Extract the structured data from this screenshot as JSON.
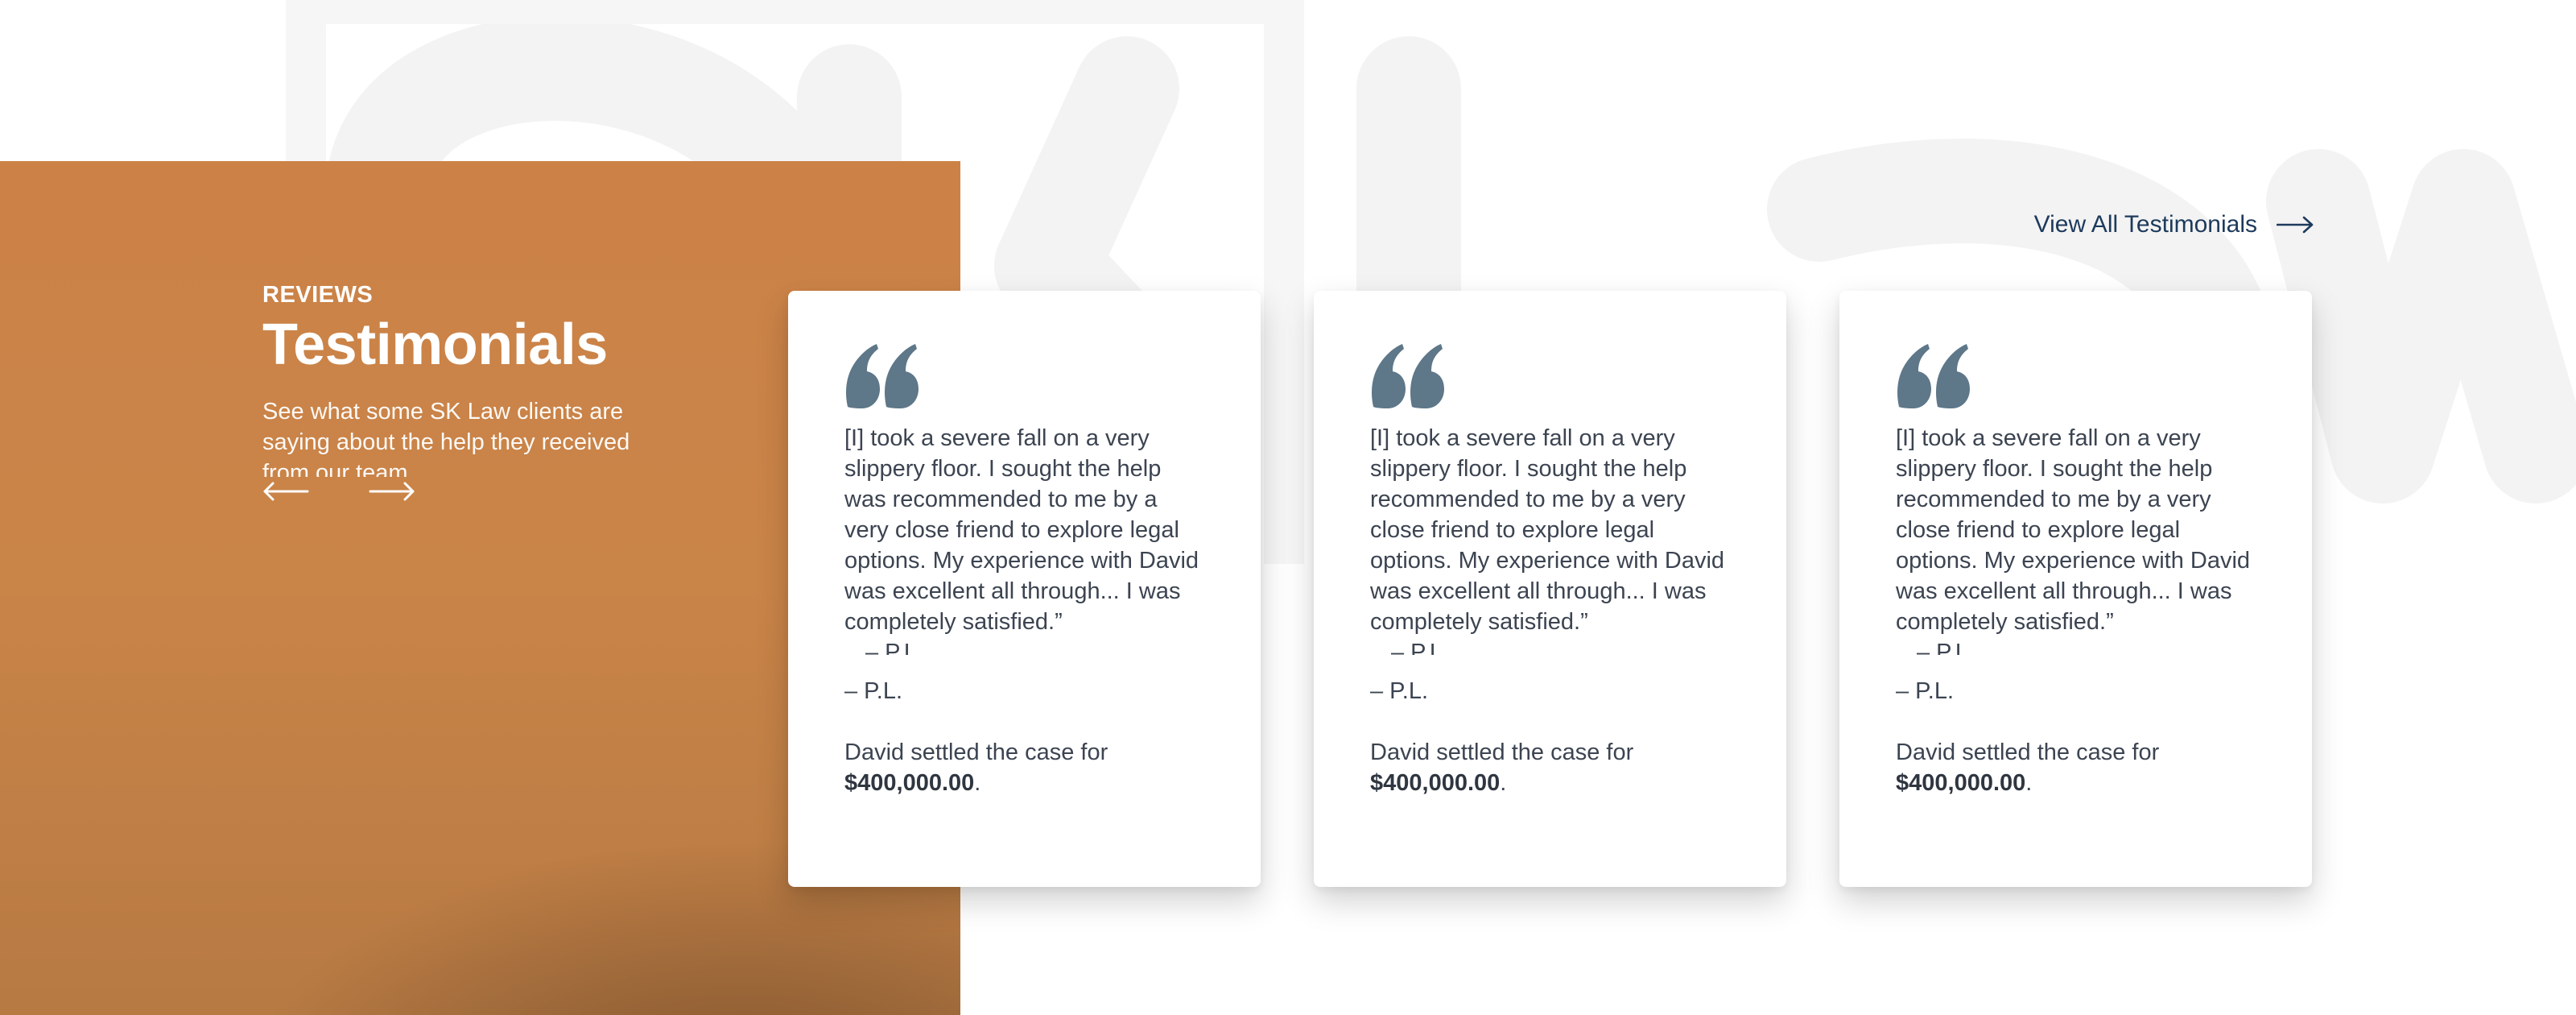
{
  "section": {
    "eyebrow": "REVIEWS",
    "title": "Testimonials",
    "intro": "See what some SK Law clients are saying about the help they received from our team."
  },
  "nav": {
    "prev_icon": "arrow-left-icon",
    "next_icon": "arrow-right-icon",
    "view_all_label": "View All Testimonials",
    "view_all_icon": "arrow-right-icon"
  },
  "testimonials": [
    {
      "quote": "[I] took a severe fall on a very slippery floor. I sought the help was recommended to me by a very close friend to explore legal options. My experience with David was excellent all through... I was completely satisfied.”",
      "clipped_author": "– P.L.",
      "author": "– P.L.",
      "settle_prefix": "David settled the case for",
      "amount": "$400,000.00",
      "settle_suffix": "."
    },
    {
      "quote": "[I] took a severe fall on a very slippery floor. I sought the help recommended to me by a very close friend to explore legal options. My experience with David was excellent all through... I was completely satisfied.”",
      "clipped_author": "– P.L.",
      "author": "– P.L.",
      "settle_prefix": "David settled the case for",
      "amount": "$400,000.00",
      "settle_suffix": "."
    },
    {
      "quote": "[I] took a severe fall on a very slippery floor. I sought the help recommended to me by a very close friend to explore legal options. My experience with David was excellent all through... I was completely satisfied.”",
      "clipped_author": "– P.L.",
      "author": "– P.L.",
      "settle_prefix": "David settled the case for",
      "amount": "$400,000.00",
      "settle_suffix": "."
    }
  ],
  "colors": {
    "panel_orange": "#cc8247",
    "link_navy": "#1d3a5c",
    "quote_mark": "#5e7789",
    "body_text": "#3c4451",
    "watermark": "#f4f4f4"
  }
}
